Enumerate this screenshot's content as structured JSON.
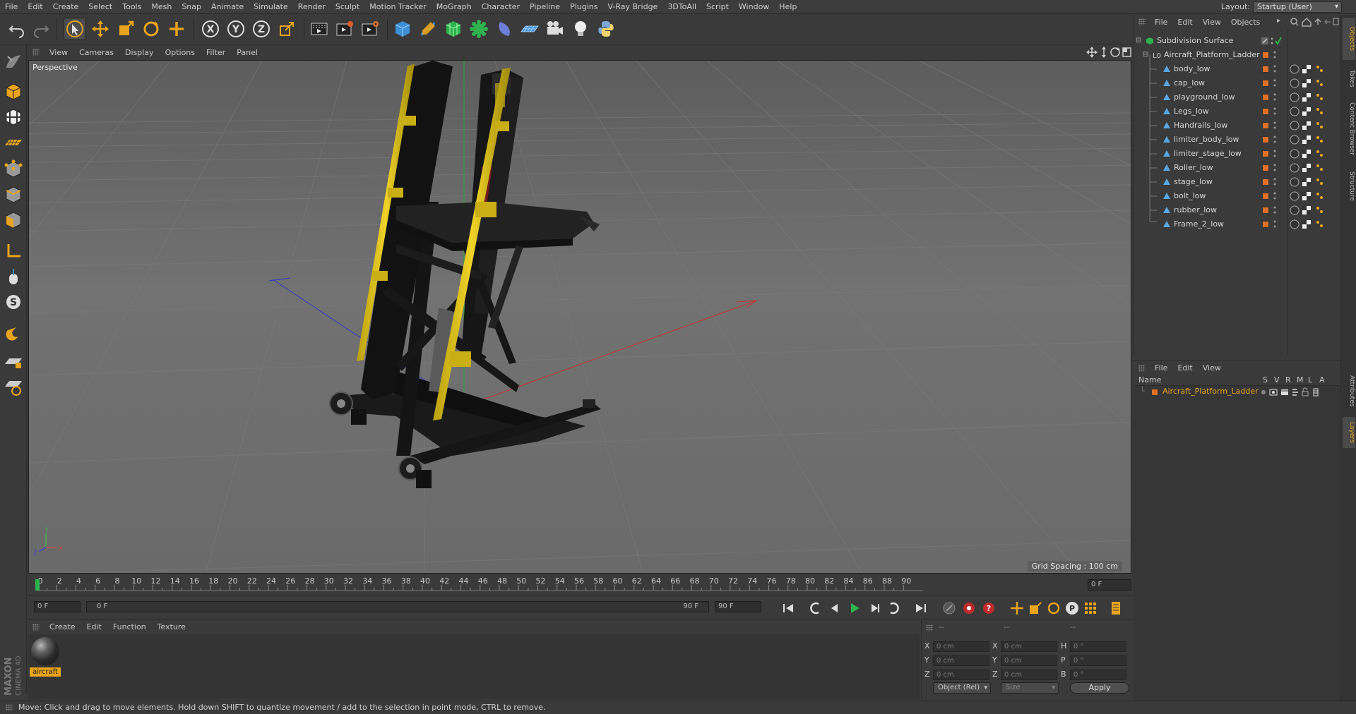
{
  "menubar": {
    "items": [
      "File",
      "Edit",
      "Create",
      "Select",
      "Tools",
      "Mesh",
      "Snap",
      "Animate",
      "Simulate",
      "Render",
      "Sculpt",
      "Motion Tracker",
      "MoGraph",
      "Character",
      "Pipeline",
      "Plugins",
      "V-Ray Bridge",
      "3DToAll",
      "Script",
      "Window",
      "Help"
    ],
    "layout_label": "Layout:",
    "layout_value": "Startup (User)"
  },
  "toolbar": {
    "icons": [
      "undo-icon",
      "redo-icon",
      "select-arrow-icon",
      "move-icon",
      "scale-icon",
      "rotate-icon",
      "add-icon",
      "x-axis-icon",
      "y-axis-icon",
      "z-axis-icon",
      "coordinate-system-icon",
      "render-view-icon",
      "render-picture-viewer-icon",
      "edit-render-settings-icon",
      "cube-icon",
      "pen-icon",
      "subdivision-icon",
      "cloner-icon",
      "deformer-icon",
      "floor-icon",
      "camera-icon",
      "light-icon",
      "python-icon"
    ]
  },
  "viewport": {
    "menu": [
      "View",
      "Cameras",
      "Display",
      "Options",
      "Filter",
      "Panel"
    ],
    "label": "Perspective",
    "grid_spacing": "Grid Spacing : 100 cm"
  },
  "timeline": {
    "ticks": [
      "0",
      "2",
      "4",
      "6",
      "8",
      "10",
      "12",
      "14",
      "16",
      "18",
      "20",
      "22",
      "24",
      "26",
      "28",
      "30",
      "32",
      "34",
      "36",
      "38",
      "40",
      "42",
      "44",
      "46",
      "48",
      "50",
      "52",
      "54",
      "56",
      "58",
      "60",
      "62",
      "64",
      "66",
      "68",
      "70",
      "72",
      "74",
      "76",
      "78",
      "80",
      "82",
      "84",
      "86",
      "88",
      "90"
    ],
    "current_frame_field": "0 F"
  },
  "transport": {
    "start_field": "0 F",
    "range_start": "0 F",
    "range_end": "90 F",
    "end_field": "90 F"
  },
  "material_manager": {
    "menu": [
      "Create",
      "Edit",
      "Function",
      "Texture"
    ],
    "material_name": "aircraft"
  },
  "coordinates": {
    "header_dashes": [
      "--",
      "--",
      "--"
    ],
    "rows": [
      {
        "l1": "X",
        "v1": "0 cm",
        "l2": "X",
        "v2": "0 cm",
        "l3": "H",
        "v3": "0 °"
      },
      {
        "l1": "Y",
        "v1": "0 cm",
        "l2": "Y",
        "v2": "0 cm",
        "l3": "P",
        "v3": "0 °"
      },
      {
        "l1": "Z",
        "v1": "0 cm",
        "l2": "Z",
        "v2": "0 cm",
        "l3": "B",
        "v3": "0 °"
      }
    ],
    "mode": "Object (Rel)",
    "size_mode": "Size",
    "apply": "Apply"
  },
  "status": "Move: Click and drag to move elements. Hold down SHIFT to quantize movement / add to the selection in point mode, CTRL to remove.",
  "object_manager": {
    "menu": [
      "File",
      "Edit",
      "View",
      "Objects"
    ],
    "root": "Subdivision Surface",
    "group": "Aircraft_Platform_Ladder",
    "children": [
      "body_low",
      "cap_low",
      "playground_low",
      "Legs_low",
      "Handrails_low",
      "limiter_body_low",
      "limiter_stage_low",
      "Roller_low",
      "stage_low",
      "bolt_low",
      "rubber_low",
      "Frame_2_low"
    ]
  },
  "layer_manager": {
    "menu": [
      "File",
      "Edit",
      "View"
    ],
    "columns": [
      "Name",
      "S",
      "V",
      "R",
      "M",
      "L",
      "A"
    ],
    "layer_name": "Aircraft_Platform_Ladder",
    "layer_color": "#e07028"
  },
  "right_tabs": [
    "Objects",
    "Takes",
    "Content Browser",
    "Structure",
    "Attributes",
    "Layers"
  ],
  "brand": {
    "maxon": "MAXON",
    "product": "CINEMA 4D"
  },
  "colors": {
    "accent": "#e8a41c",
    "layer": "#e07028",
    "viewport_bg": "#6e6e6e"
  }
}
